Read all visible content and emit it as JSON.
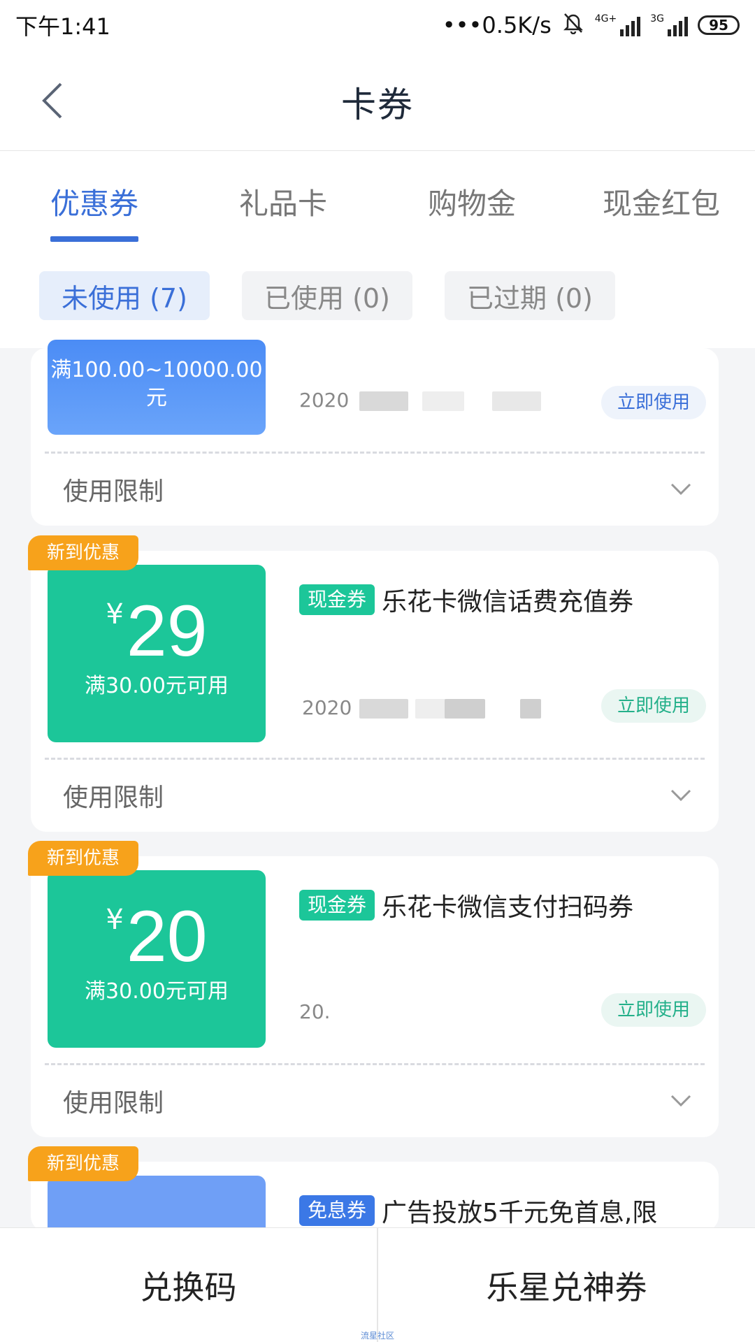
{
  "status_bar": {
    "time": "下午1:41",
    "network_speed": "•••0.5K/s",
    "network_4g": "4G+",
    "network_3g": "3G",
    "battery": "95"
  },
  "nav": {
    "title": "卡券"
  },
  "tabs": [
    {
      "label": "优惠券",
      "active": true
    },
    {
      "label": "礼品卡",
      "active": false
    },
    {
      "label": "购物金",
      "active": false
    },
    {
      "label": "现金红包",
      "active": false
    }
  ],
  "filters": [
    {
      "label": "未使用 (7)",
      "active": true
    },
    {
      "label": "已使用 (0)",
      "active": false
    },
    {
      "label": "已过期 (0)",
      "active": false
    }
  ],
  "coupons": [
    {
      "condition_line1": "满100.00~10000.00",
      "condition_line2": "元",
      "date": "2020",
      "use_label": "立即使用",
      "limit_label": "使用限制"
    },
    {
      "badge": "新到优惠",
      "currency": "¥",
      "amount": "29",
      "condition": "满30.00元可用",
      "type": "现金券",
      "title": "乐花卡微信话费充值券",
      "date": "2020",
      "use_label": "立即使用",
      "limit_label": "使用限制"
    },
    {
      "badge": "新到优惠",
      "currency": "¥",
      "amount": "20",
      "condition": "满30.00元可用",
      "type": "现金券",
      "title": "乐花卡微信支付扫码券",
      "date": "20.",
      "use_label": "立即使用",
      "limit_label": "使用限制"
    },
    {
      "badge": "新到优惠",
      "type": "免息券",
      "title": "广告投放5千元免首息,限"
    }
  ],
  "bottom": {
    "redeem_code": "兑换码",
    "lexing": "乐星兑神券"
  },
  "watermark": "流星社区",
  "colors": {
    "accent_blue": "#3a6fd8",
    "coupon_green": "#1cc699",
    "badge_orange": "#f7a21b"
  }
}
